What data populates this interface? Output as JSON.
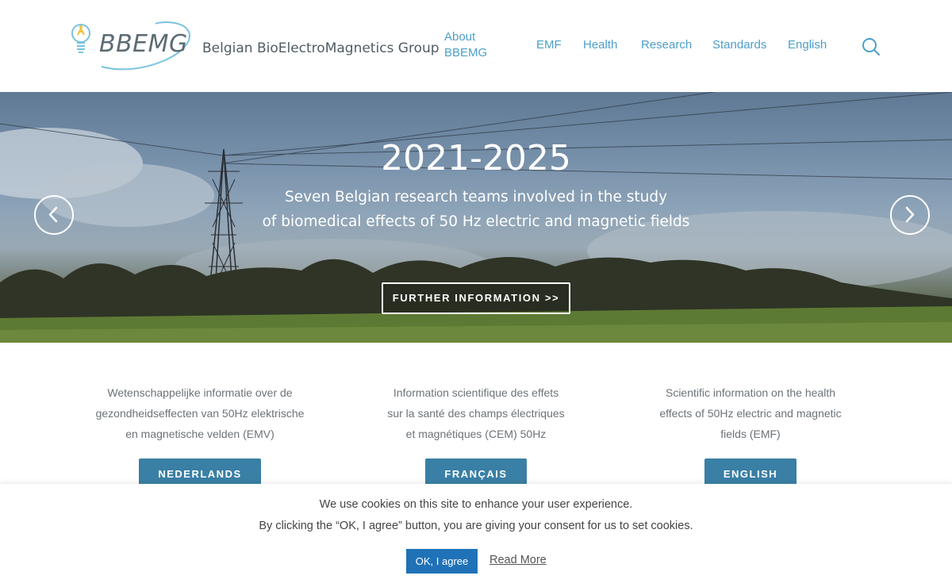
{
  "header": {
    "logo_abbr": "BBEMG",
    "logo_full": "Belgian BioElectroMagnetics Group",
    "nav": {
      "about": "About BBEMG",
      "emf": "EMF",
      "health": "Health",
      "research": "Research",
      "standards": "Standards",
      "language": "English"
    },
    "search_icon": "search-icon"
  },
  "hero": {
    "title": "2021-2025",
    "subtitle_line1": "Seven Belgian research teams involved in the study",
    "subtitle_line2": "of biomedical effects of 50 Hz electric and magnetic fields",
    "button": "FURTHER INFORMATION >>",
    "prev_icon": "chevron-left-icon",
    "next_icon": "chevron-right-icon"
  },
  "languages": [
    {
      "text_lines": [
        "Wetenschappelijke informatie over de",
        "gezondheidseffecten van 50Hz elektrische",
        "en magnetische velden (EMV)"
      ],
      "button": "NEDERLANDS"
    },
    {
      "text_lines": [
        "Information scientifique des effets",
        "sur la santé des champs électriques",
        "et magnétiques (CEM) 50Hz"
      ],
      "button": "FRANÇAIS"
    },
    {
      "text_lines": [
        "Scientific information on the health",
        "effects of 50Hz electric and magnetic",
        "fields (EMF)"
      ],
      "button": "ENGLISH"
    }
  ],
  "cookie": {
    "line1": "We use cookies on this site to enhance your user experience.",
    "line2": "By clicking the “OK, I agree” button, you are giving your consent for us to set cookies.",
    "ok": "OK, I agree",
    "more": "Read More"
  },
  "colors": {
    "nav_link": "#4c9fc8",
    "button_bg": "#3a7fa5",
    "cookie_ok_bg": "#1f72b8"
  }
}
